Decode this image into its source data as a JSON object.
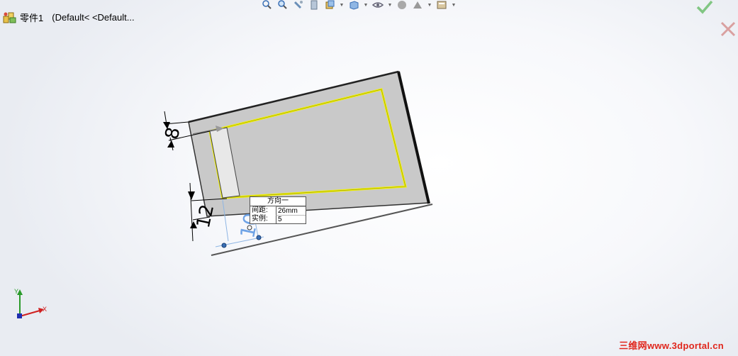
{
  "document": {
    "name": "零件1",
    "configuration": "(Default< <Default..."
  },
  "toolbar": {
    "items": [
      "zoom-to-fit-icon",
      "zoom-area-icon",
      "previous-view-icon",
      "section-view-icon",
      "view-orientation-icon",
      "display-style-icon",
      "hide-show-items-icon",
      "edit-appearance-icon",
      "apply-scene-icon",
      "view-settings-icon"
    ]
  },
  "dimensions": {
    "top_offset": "8",
    "bottom_offset": "12",
    "spacing_preview": "10"
  },
  "pattern_callout": {
    "header": "方向一",
    "spacing_label": "间距:",
    "spacing_value": "26mm",
    "instances_label": "实例:",
    "instances_value": "5"
  },
  "triad": {
    "x_label": "X",
    "y_label": "Y"
  },
  "watermark": "三维网www.3dportal.cn",
  "colors": {
    "face": "#c9c9c9",
    "sketch": "#f4f400",
    "confirm": "#5cb85c",
    "cancel": "#d9a0a0"
  }
}
